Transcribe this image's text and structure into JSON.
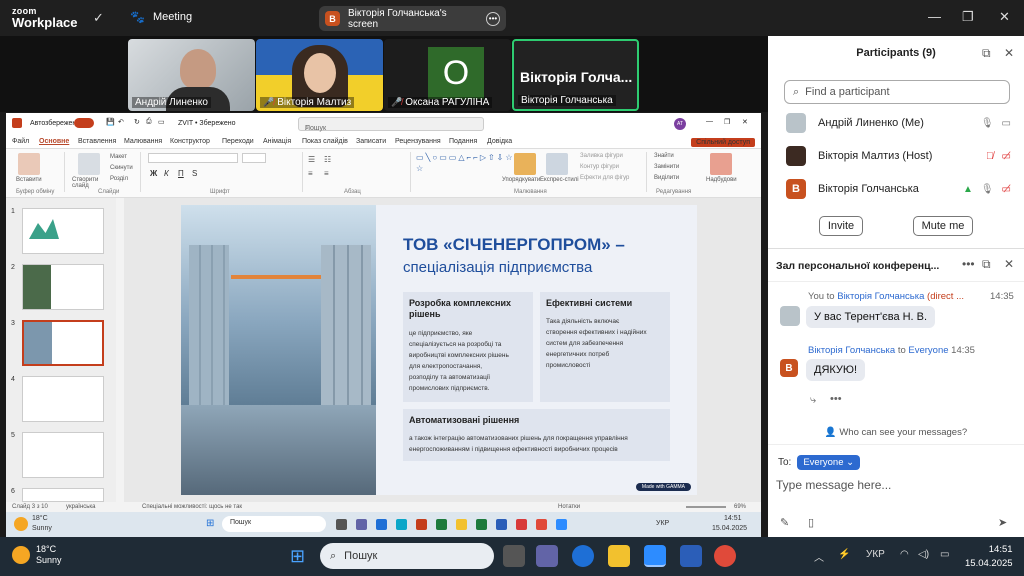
{
  "zoom": {
    "logo_line1": "zoom",
    "logo_line2": "Workplace",
    "meeting_label": "Meeting",
    "share_initial": "В",
    "share_label": "Вікторія Голчанська's screen"
  },
  "video_tiles": [
    {
      "name": "Андрій Линенко",
      "muted": false
    },
    {
      "name": "Вікторія Малтиз",
      "muted": true
    },
    {
      "name": "Оксана РАГУЛІНА",
      "muted": true,
      "avatar_letter": "О"
    },
    {
      "name": "Вікторія Голчанська",
      "big_name": "Вікторія Голча..."
    }
  ],
  "ppt": {
    "autosave": "Автозбереження",
    "filename": "ZVIT • Збережено",
    "search_placeholder": "Пошук",
    "user_initials": "AT",
    "tabs": [
      "Файл",
      "Основне",
      "Вставлення",
      "Малювання",
      "Конструктор",
      "Переходи",
      "Анімація",
      "Показ слайдів",
      "Записати",
      "Рецензування",
      "Подання",
      "Довідка"
    ],
    "share_btn": "Спільний доступ",
    "ribbon": {
      "paste": "Вставити",
      "clipboard": "Буфер обміну",
      "new_slide": "Створити слайд",
      "layout": "Макет",
      "reset": "Скинути",
      "section": "Розділ",
      "slides": "Слайди",
      "font": "Шрифт",
      "paragraph": "Абзац",
      "arrange": "Упорядкувати",
      "quick_styles": "Експрес-стилі",
      "fill": "Заливка фігури",
      "outline": "Контур фігури",
      "effects": "Ефекти для фігур",
      "drawing": "Малювання",
      "find": "Знайти",
      "replace": "Замінити",
      "select": "Виділити",
      "editing": "Редагування",
      "designer": "Надбудови"
    },
    "slide_numbers": [
      "1",
      "2",
      "3",
      "4",
      "5",
      "6"
    ],
    "slide": {
      "title_line1": "ТОВ «СІЧЕНЕРГОПРОМ» –",
      "title_line2": "спеціалізація підприємства",
      "card1_h": "Розробка комплексних рішень",
      "card1_t": [
        "це підприємство, яке",
        "спеціалізується на розробці та",
        "виробництві комплексних рішень",
        "для електропостачання,",
        "розподілу та автоматизації",
        "промислових підприємств."
      ],
      "card2_h": "Ефективні системи",
      "card2_t": [
        "Така діяльність включає",
        "створення ефективних і надійних",
        "систем для забезпечення",
        "енергетичних потреб",
        "промисловості"
      ],
      "card3_h": "Автоматизовані рішення",
      "card3_t": [
        "а також інтеграцію автоматизованих рішень для покращення управління",
        "енергоспоживанням і підвищення ефективності виробничих процесів"
      ],
      "madewith": "Made with GAMMA"
    },
    "status": {
      "slide_of": "Слайд 3 з 10",
      "lang": "українська",
      "accessibility": "Спеціальні можливості: щось не так",
      "notes": "Нотатки",
      "zoom": "69%"
    },
    "inner_taskbar": {
      "temp": "18°C",
      "cond": "Sunny",
      "search": "Пошук",
      "lang": "УКР",
      "time": "14:51",
      "date": "15.04.2025"
    }
  },
  "participants": {
    "title": "Participants (9)",
    "find_placeholder": "Find a participant",
    "list": [
      {
        "name": "Андрій Линенко (Me)"
      },
      {
        "name": "Вікторія Малтиз (Host)"
      },
      {
        "name": "Вікторія Голчанська",
        "initial": "В"
      }
    ],
    "invite": "Invite",
    "mute_me": "Mute me"
  },
  "chat": {
    "title": "Зал персональної конференц...",
    "msg1_prefix": "You to",
    "msg1_to": "Вікторія Голчанська",
    "msg1_tag": "(direct ...",
    "msg1_time": "14:35",
    "msg1_text": "У вас Терент'єва Н. В.",
    "msg2_from": "Вікторія Голчанська",
    "msg2_mid": "to",
    "msg2_to": "Everyone",
    "msg2_time": "14:35",
    "msg2_initial": "В",
    "msg2_text": "ДЯКУЮ!",
    "who_can_see": "Who can see your messages?",
    "to_label": "To:",
    "everyone_btn": "Everyone",
    "type_placeholder": "Type message here..."
  },
  "taskbar": {
    "temp": "18°C",
    "cond": "Sunny",
    "search": "Пошук",
    "lang": "УКР",
    "time": "14:51",
    "date": "15.04.2025"
  }
}
